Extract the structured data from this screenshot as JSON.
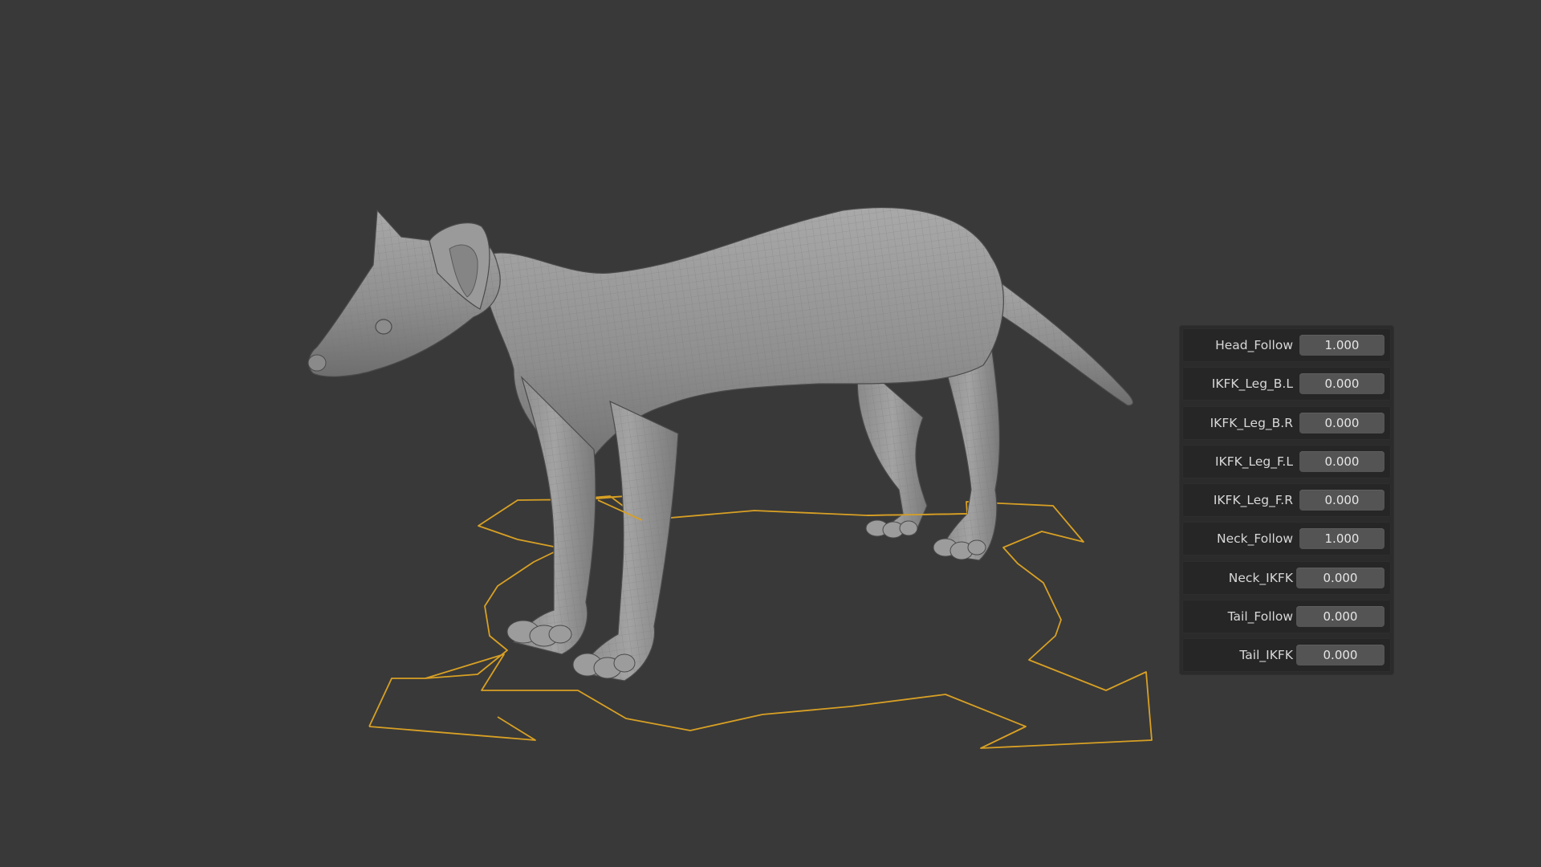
{
  "viewport": {
    "background": "#393939",
    "subject_icon": "ferret-character-mesh",
    "controller_color": "#d8a024"
  },
  "properties": [
    {
      "label": "Head_Follow",
      "value": "1.000"
    },
    {
      "label": "IKFK_Leg_B.L",
      "value": "0.000"
    },
    {
      "label": "IKFK_Leg_B.R",
      "value": "0.000"
    },
    {
      "label": "IKFK_Leg_F.L",
      "value": "0.000"
    },
    {
      "label": "IKFK_Leg_F.R",
      "value": "0.000"
    },
    {
      "label": "Neck_Follow",
      "value": "1.000"
    },
    {
      "label": "Neck_IKFK",
      "value": "0.000"
    },
    {
      "label": "Tail_Follow",
      "value": "0.000"
    },
    {
      "label": "Tail_IKFK",
      "value": "0.000"
    }
  ]
}
